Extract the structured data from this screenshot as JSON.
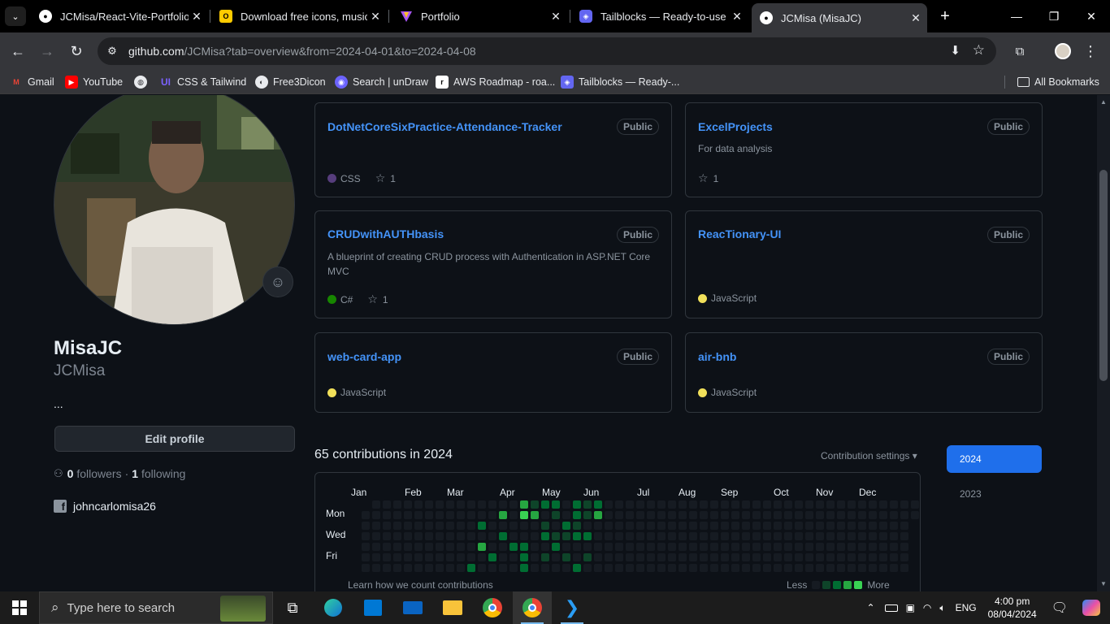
{
  "tabs": [
    {
      "title": "JCMisa/React-Vite-Portfolio",
      "icon": "github-icon",
      "active": false
    },
    {
      "title": "Download free icons, music,",
      "icon": "iconsout-icon",
      "active": false
    },
    {
      "title": "Portfolio",
      "icon": "vite-icon",
      "active": false
    },
    {
      "title": "Tailblocks — Ready-to-use T",
      "icon": "tailblocks-icon",
      "active": false
    },
    {
      "title": "JCMisa (MisaJC)",
      "icon": "github-icon",
      "active": true
    }
  ],
  "address": {
    "host": "github.com",
    "path": "/JCMisa?tab=overview&from=2024-04-01&to=2024-04-08"
  },
  "bookmarks": [
    {
      "label": "Gmail",
      "icon": "gmail-icon",
      "color": "#ea4335"
    },
    {
      "label": "YouTube",
      "icon": "youtube-icon",
      "color": "#ff0000"
    },
    {
      "label": "",
      "icon": "globe-icon",
      "color": "#e8eaed"
    },
    {
      "label": "CSS & Tailwind",
      "icon": "ui-icon",
      "color": "#7b61ff"
    },
    {
      "label": "Free3Dicon",
      "icon": "free3d-icon",
      "color": "#e8eaed"
    },
    {
      "label": "Search | unDraw",
      "icon": "undraw-icon",
      "color": "#6c63ff"
    },
    {
      "label": "AWS Roadmap - roa...",
      "icon": "roadmap-icon",
      "color": "#ffffff"
    },
    {
      "label": "Tailblocks — Ready-...",
      "icon": "tailblocks-icon",
      "color": "#6366f1"
    }
  ],
  "all_bookmarks": "All Bookmarks",
  "profile": {
    "display_name": "MisaJC",
    "username": "JCMisa",
    "bio": "...",
    "edit_button": "Edit profile",
    "followers_count": "0",
    "followers_label": "followers",
    "separator": "·",
    "following_count": "1",
    "following_label": "following",
    "facebook": "johncarlomisa26"
  },
  "repos": [
    {
      "name": "DotNetCoreSixPractice-Attendance-Tracker",
      "visibility": "Public",
      "description": "",
      "language": "CSS",
      "lang_color": "#563d7c",
      "stars": "1"
    },
    {
      "name": "ExcelProjects",
      "visibility": "Public",
      "description": "For data analysis",
      "language": "",
      "lang_color": "",
      "stars": "1"
    },
    {
      "name": "CRUDwithAUTHbasis",
      "visibility": "Public",
      "description": "A blueprint of creating CRUD process with Authentication in ASP.NET Core MVC",
      "language": "C#",
      "lang_color": "#178600",
      "stars": "1"
    },
    {
      "name": "ReacTionary-UI",
      "visibility": "Public",
      "description": "",
      "language": "JavaScript",
      "lang_color": "#f1e05a",
      "stars": ""
    },
    {
      "name": "web-card-app",
      "visibility": "Public",
      "description": "",
      "language": "JavaScript",
      "lang_color": "#f1e05a",
      "stars": ""
    },
    {
      "name": "air-bnb",
      "visibility": "Public",
      "description": "",
      "language": "JavaScript",
      "lang_color": "#f1e05a",
      "stars": ""
    }
  ],
  "contributions": {
    "title": "65 contributions in 2024",
    "settings": "Contribution settings ▾",
    "months": [
      "Jan",
      "Feb",
      "Mar",
      "Apr",
      "May",
      "Jun",
      "Jul",
      "Aug",
      "Sep",
      "Oct",
      "Nov",
      "Dec"
    ],
    "days": [
      "Mon",
      "Wed",
      "Fri"
    ],
    "learn": "Learn how we count contributions",
    "less": "Less",
    "more": "More",
    "levels": [
      "#161b22",
      "#0e4429",
      "#006d32",
      "#26a641",
      "#39d353"
    ]
  },
  "years": [
    "2024",
    "2023"
  ],
  "taskbar": {
    "search_placeholder": "Type here to search",
    "lang": "ENG",
    "time": "4:00 pm",
    "date": "08/04/2024"
  }
}
